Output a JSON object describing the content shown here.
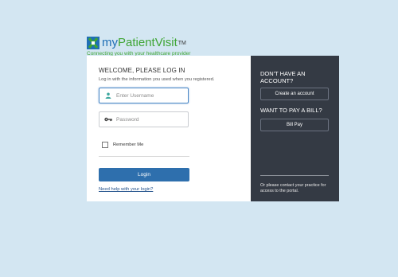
{
  "brand": {
    "name_prefix": "my",
    "name_suffix": "PatientVisit",
    "trademark": "TM",
    "tagline": "Connecting you with your healthcare provider"
  },
  "login": {
    "heading": "WELCOME, PLEASE LOG IN",
    "subtitle": "Log in with the information you used when you registered.",
    "username_placeholder": "Enter Username",
    "password_placeholder": "Password",
    "remember_label": "Remember Me",
    "login_button": "Login",
    "help_link": "Need help with your login?"
  },
  "side": {
    "no_account_heading": "DON'T HAVE AN ACCOUNT?",
    "create_account_button": "Create an account",
    "pay_bill_heading": "WANT TO PAY A BILL?",
    "bill_pay_button": "Bill Pay",
    "contact_text": "Or please contact your practice for access to the portal."
  },
  "colors": {
    "background": "#d3e6f2",
    "accent_blue": "#2e6fad",
    "brand_green": "#3fa535",
    "side_panel": "#343a44"
  },
  "icons": [
    "mypatientvisit-logo-icon",
    "user-icon",
    "key-icon"
  ]
}
